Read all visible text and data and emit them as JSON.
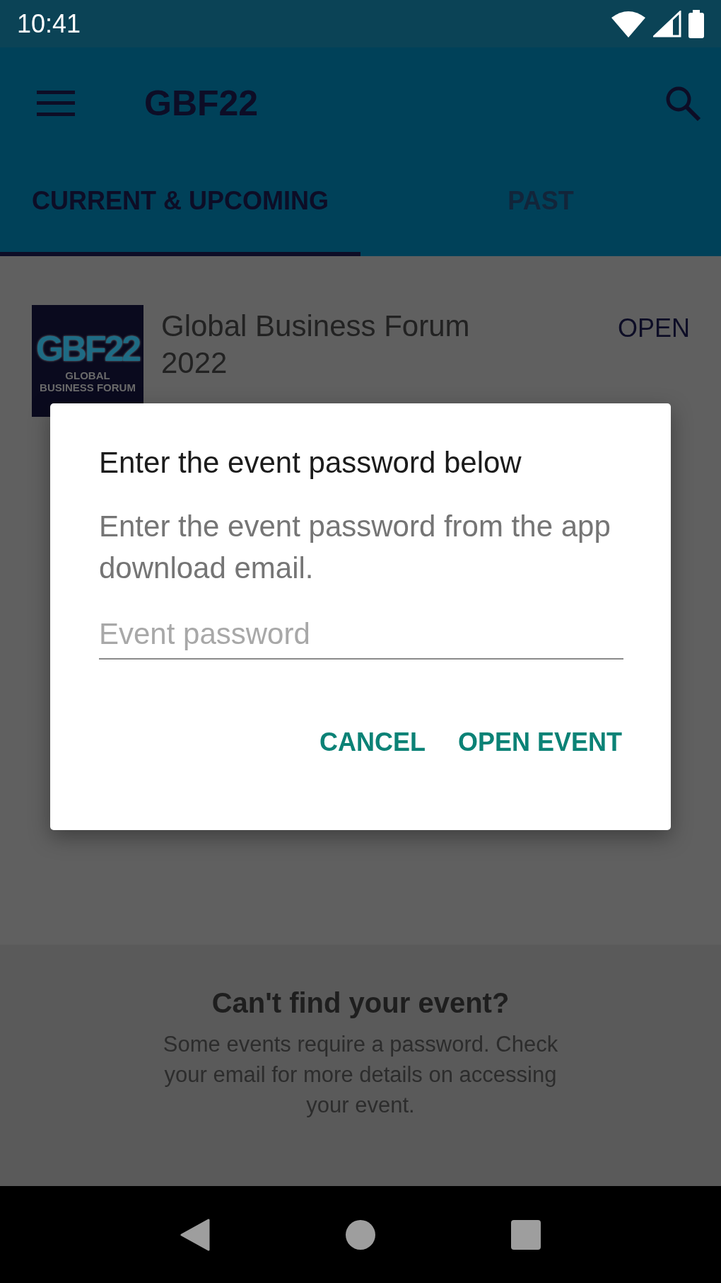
{
  "status_bar": {
    "time": "10:41"
  },
  "app_bar": {
    "title": "GBF22"
  },
  "tabs": [
    {
      "label": "CURRENT & UPCOMING",
      "selected": true
    },
    {
      "label": "PAST",
      "selected": false
    }
  ],
  "events": [
    {
      "logo": {
        "mark": "GBF22",
        "caption": "GLOBAL BUSINESS FORUM"
      },
      "title": "Global Business Forum 2022",
      "action": "OPEN"
    }
  ],
  "dialog": {
    "title": "Enter the event password below",
    "message": "Enter the event password from the app download email.",
    "field": {
      "placeholder": "Event password"
    },
    "buttons": [
      "CANCEL",
      "OPEN EVENT"
    ]
  },
  "footer": {
    "title": "Can't find your event?",
    "text": "Some events require a password. Check your email for more details on accessing your event."
  }
}
